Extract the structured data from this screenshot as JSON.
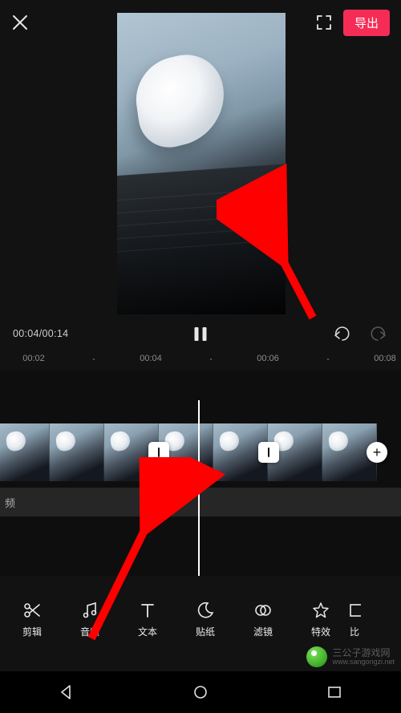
{
  "topbar": {
    "export_label": "导出"
  },
  "playback": {
    "time_display": "00:04/00:14"
  },
  "ruler": {
    "ticks": [
      "00:02",
      "00:04",
      "00:06",
      "00:08"
    ]
  },
  "timeline": {
    "add_label": "+",
    "audio_row_label": "频"
  },
  "tools": [
    {
      "id": "edit",
      "label": "剪辑",
      "icon": "scissors-icon"
    },
    {
      "id": "audio",
      "label": "音频",
      "icon": "music-note-icon"
    },
    {
      "id": "text",
      "label": "文本",
      "icon": "text-icon"
    },
    {
      "id": "sticker",
      "label": "贴纸",
      "icon": "moon-icon"
    },
    {
      "id": "filter",
      "label": "滤镜",
      "icon": "overlap-circles-icon"
    },
    {
      "id": "effect",
      "label": "特效",
      "icon": "star-icon"
    },
    {
      "id": "ratio",
      "label": "比",
      "icon": "ratio-icon"
    }
  ],
  "watermark": {
    "line1": "三公子游戏网",
    "line2": "www.sangongzi.net"
  },
  "colors": {
    "accent": "#f52d56"
  }
}
